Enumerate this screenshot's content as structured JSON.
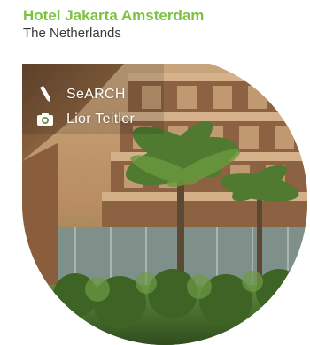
{
  "hotel": {
    "name": "Hotel Jakarta Amsterdam",
    "country": "The Netherlands"
  },
  "credits": {
    "architect_icon": "pen-icon",
    "architect": "SeARCH",
    "photographer_icon": "camera-icon",
    "photographer": "Lior Teitler"
  },
  "colors": {
    "title": "#7dc242",
    "subtitle": "#3a3a3a",
    "credit_text": "#ffffff"
  }
}
